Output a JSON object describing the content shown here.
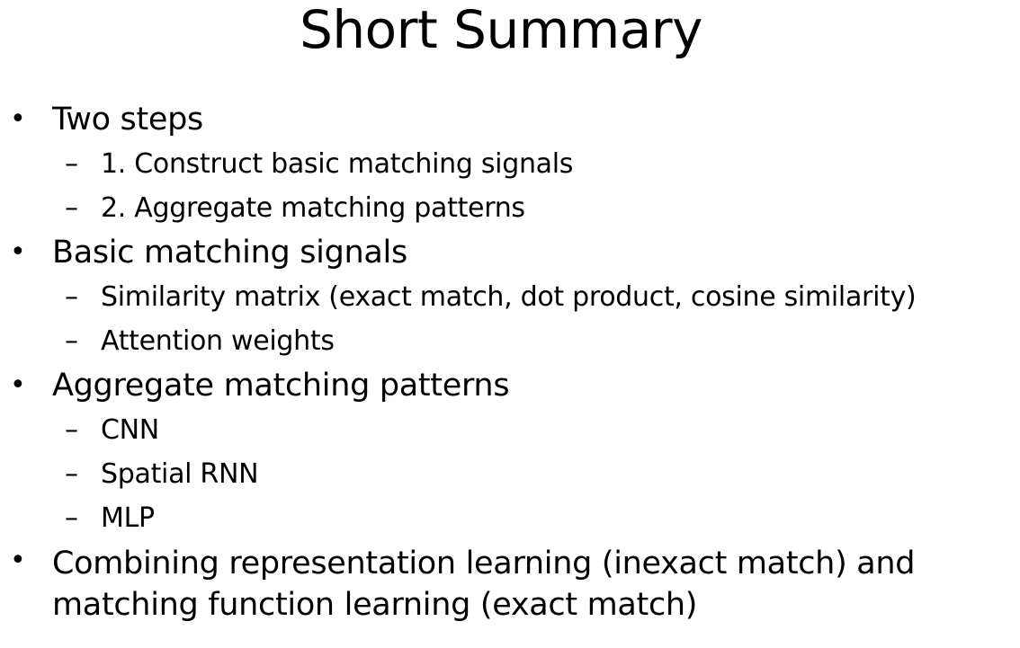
{
  "slide": {
    "title": "Short Summary",
    "bullet_symbol": "•",
    "dash_symbol": "–",
    "items": [
      {
        "text": "Two steps",
        "subitems": [
          "1. Construct basic matching signals",
          "2. Aggregate matching patterns"
        ]
      },
      {
        "text": "Basic matching signals",
        "subitems": [
          "Similarity matrix (exact match, dot product, cosine similarity)",
          "Attention weights"
        ]
      },
      {
        "text": "Aggregate matching patterns",
        "subitems": [
          "CNN",
          "Spatial RNN",
          "MLP"
        ]
      },
      {
        "text": "Combining representation learning (inexact match) and matching function learning (exact match)",
        "subitems": []
      }
    ]
  }
}
